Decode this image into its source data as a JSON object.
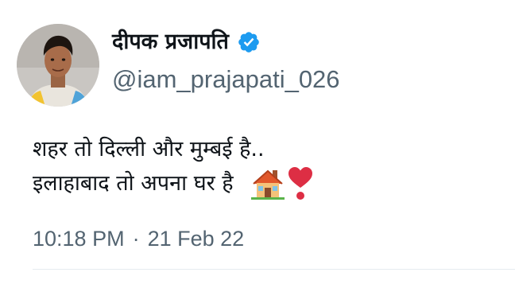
{
  "tweet": {
    "author": {
      "display_name": "दीपक प्रजापति",
      "handle": "@iam_prajapati_026",
      "verified": true,
      "verified_color": "#1d9bf0"
    },
    "text_lines": [
      "शहर तो दिल्ली और मुम्बई है..",
      "इलाहाबाद तो अपना घर है"
    ],
    "emojis": [
      "house-emoji",
      "heart-exclamation-emoji"
    ],
    "time": "10:18 PM",
    "separator": "·",
    "date": "21 Feb 22"
  },
  "colors": {
    "text": "#0f1419",
    "secondary": "#536471",
    "accent": "#1d9bf0"
  }
}
